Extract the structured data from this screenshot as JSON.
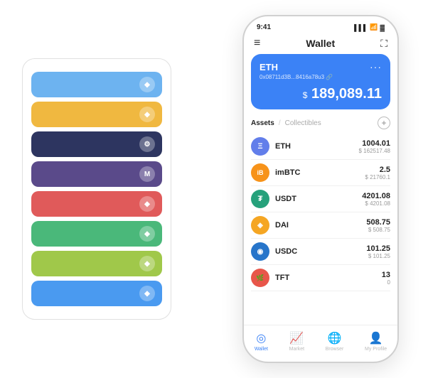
{
  "scene": {
    "background_color": "#ffffff"
  },
  "card_stack": {
    "cards": [
      {
        "color": "#6db3f0",
        "icon": "◆"
      },
      {
        "color": "#f0b840",
        "icon": "◆"
      },
      {
        "color": "#2d3560",
        "icon": "⚙"
      },
      {
        "color": "#5a4a8a",
        "icon": "M"
      },
      {
        "color": "#e05a5a",
        "icon": "◆"
      },
      {
        "color": "#4ab87a",
        "icon": "◆"
      },
      {
        "color": "#a0c84a",
        "icon": "◆"
      },
      {
        "color": "#4a9af0",
        "icon": "◆"
      }
    ]
  },
  "phone": {
    "status_bar": {
      "time": "9:41",
      "signal": "▌▌▌",
      "wifi": "WiFi",
      "battery": "🔋"
    },
    "header": {
      "menu_icon": "≡",
      "title": "Wallet",
      "expand_icon": "⛶"
    },
    "eth_card": {
      "title": "ETH",
      "dots": "···",
      "address": "0x08711d3B...8416a78u3 🔗",
      "balance_prefix": "$",
      "balance": "189,089.11",
      "bg_color": "#3b82f6"
    },
    "assets_section": {
      "tab_active": "Assets",
      "tab_divider": "/",
      "tab_inactive": "Collectibles",
      "add_icon": "+"
    },
    "assets": [
      {
        "name": "ETH",
        "icon_color": "#627eea",
        "icon_text": "Ξ",
        "amount": "1004.01",
        "usd": "$ 162517.48"
      },
      {
        "name": "imBTC",
        "icon_color": "#f7931a",
        "icon_text": "i",
        "amount": "2.5",
        "usd": "$ 21760.1"
      },
      {
        "name": "USDT",
        "icon_color": "#26a17b",
        "icon_text": "₮",
        "amount": "4201.08",
        "usd": "$ 4201.08"
      },
      {
        "name": "DAI",
        "icon_color": "#f5a623",
        "icon_text": "◈",
        "amount": "508.75",
        "usd": "$ 508.75"
      },
      {
        "name": "USDC",
        "icon_color": "#2775ca",
        "icon_text": "◉",
        "amount": "101.25",
        "usd": "$ 101.25"
      },
      {
        "name": "TFT",
        "icon_color": "#e8564a",
        "icon_text": "🌿",
        "amount": "13",
        "usd": "0"
      }
    ],
    "bottom_nav": [
      {
        "icon": "◎",
        "label": "Wallet",
        "active": true
      },
      {
        "icon": "📊",
        "label": "Market",
        "active": false
      },
      {
        "icon": "🌐",
        "label": "Browser",
        "active": false
      },
      {
        "icon": "👤",
        "label": "My Profile",
        "active": false
      }
    ]
  }
}
